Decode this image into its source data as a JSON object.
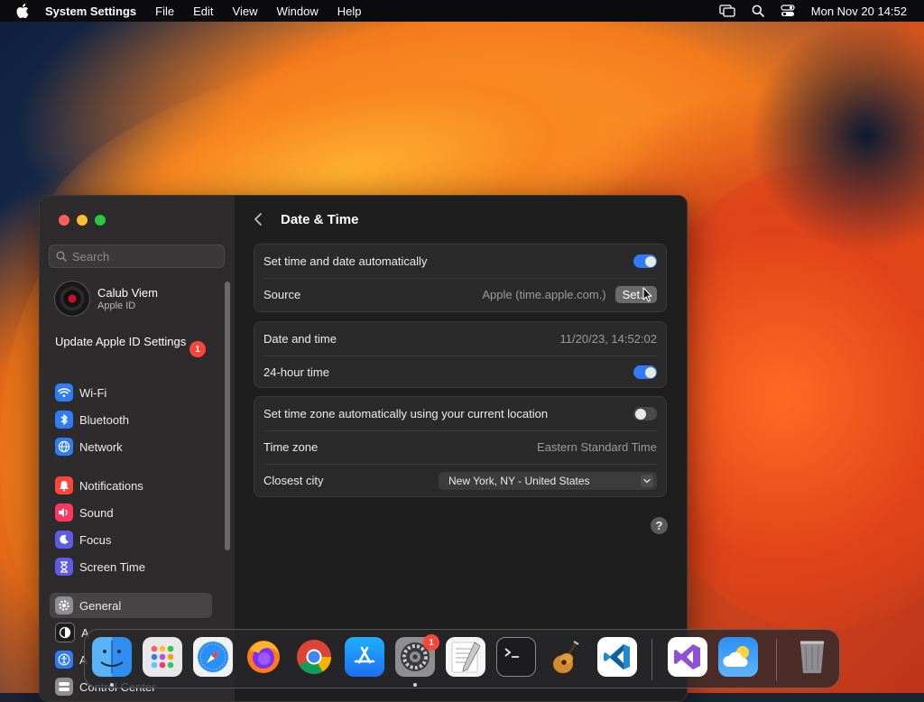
{
  "menubar": {
    "app_name": "System Settings",
    "menus": [
      "File",
      "Edit",
      "View",
      "Window",
      "Help"
    ],
    "clock": "Mon Nov 20  14:52"
  },
  "sidebar": {
    "search_placeholder": "Search",
    "account": {
      "name": "Calub Viem",
      "subtitle": "Apple ID"
    },
    "update": {
      "label": "Update Apple ID Settings",
      "badge": "1"
    },
    "items": [
      {
        "label": "Wi-Fi",
        "icon": "wifi-icon",
        "color": "#2f7cf6"
      },
      {
        "label": "Bluetooth",
        "icon": "bluetooth-icon",
        "color": "#2f7cf6"
      },
      {
        "label": "Network",
        "icon": "globe-icon",
        "color": "#2f7cf6"
      },
      {
        "label": "Notifications",
        "icon": "bell-icon",
        "color": "#ff453a"
      },
      {
        "label": "Sound",
        "icon": "speaker-icon",
        "color": "#ff375f"
      },
      {
        "label": "Focus",
        "icon": "moon-icon",
        "color": "#5e5ce6"
      },
      {
        "label": "Screen Time",
        "icon": "hourglass-icon",
        "color": "#5e5ce6"
      },
      {
        "label": "General",
        "icon": "gear-icon",
        "color": "#8e8e93",
        "selected": true
      },
      {
        "label": "A",
        "icon": "appearance-icon",
        "color": "#1c1c1e"
      },
      {
        "label": "A",
        "icon": "accessibility-icon",
        "color": "#2f7cf6"
      },
      {
        "label": "Control Center",
        "icon": "control-center-icon",
        "color": "#8e8e93"
      }
    ]
  },
  "header": {
    "title": "Date & Time"
  },
  "settings": {
    "auto_time": {
      "label": "Set time and date automatically",
      "on": true
    },
    "source": {
      "label": "Source",
      "value": "Apple (time.apple.com.)",
      "button": "Set..."
    },
    "date_time": {
      "label": "Date and time",
      "value": "11/20/23, 14:52:02"
    },
    "hour24": {
      "label": "24-hour time",
      "on": true
    },
    "auto_tz": {
      "label": "Set time zone automatically using your current location",
      "on": false
    },
    "time_zone": {
      "label": "Time zone",
      "value": "Eastern Standard Time"
    },
    "closest_city": {
      "label": "Closest city",
      "value": "New York, NY - United States"
    }
  },
  "help": "?",
  "dock": {
    "apps": [
      {
        "name": "finder-icon"
      },
      {
        "name": "launchpad-icon"
      },
      {
        "name": "safari-icon"
      },
      {
        "name": "firefox-icon"
      },
      {
        "name": "chrome-icon"
      },
      {
        "name": "app-store-icon"
      },
      {
        "name": "system-settings-icon",
        "badge": "1"
      },
      {
        "name": "textedit-icon"
      },
      {
        "name": "terminal-icon"
      },
      {
        "name": "garageband-icon"
      },
      {
        "name": "vscode-icon"
      },
      {
        "name": "visual-studio-icon"
      },
      {
        "name": "weather-icon"
      },
      {
        "name": "trash-icon"
      }
    ]
  },
  "colors": {
    "accent": "#2f7cf6",
    "badge": "#ff453a"
  }
}
